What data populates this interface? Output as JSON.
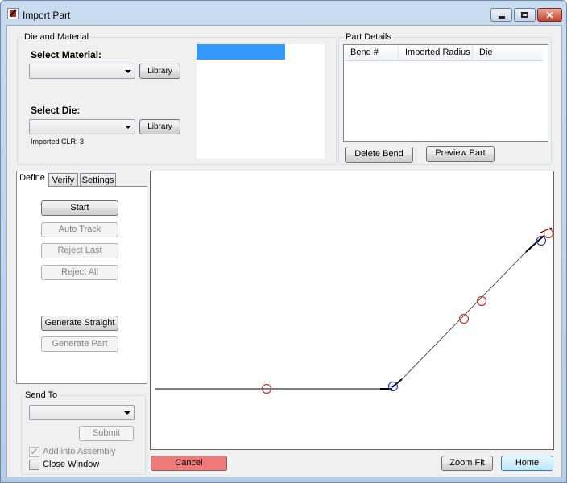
{
  "window": {
    "title": "Import Part"
  },
  "die_material": {
    "group_label": "Die and Material",
    "select_material_label": "Select Material:",
    "select_die_label": "Select Die:",
    "material_value": "",
    "die_value": "",
    "library_label": "Library",
    "imported_clr": "Imported CLR: 3"
  },
  "part_details": {
    "group_label": "Part Details",
    "columns": [
      "Bend #",
      "Imported Radius",
      "Die"
    ],
    "delete_bend_label": "Delete Bend",
    "preview_part_label": "Preview Part"
  },
  "tabs": {
    "items": [
      "Define",
      "Verify",
      "Settings"
    ],
    "active": "Define"
  },
  "define": {
    "start_label": "Start",
    "auto_track_label": "Auto Track",
    "reject_last_label": "Reject Last",
    "reject_all_label": "Reject All",
    "generate_straight_label": "Generate Straight",
    "generate_part_label": "Generate Part"
  },
  "send_to": {
    "group_label": "Send To",
    "value": "",
    "submit_label": "Submit",
    "add_into_assembly_label": "Add into Assembly",
    "add_into_assembly_checked": true,
    "close_window_label": "Close Window",
    "close_window_checked": false
  },
  "footer": {
    "cancel_label": "Cancel",
    "zoom_fit_label": "Zoom Fit",
    "home_label": "Home"
  },
  "colors": {
    "cancel_bg": "#f07a7a",
    "selection_blue": "#3399ff",
    "marker_red": "#c0392b",
    "marker_blue": "#2c3fbf"
  }
}
